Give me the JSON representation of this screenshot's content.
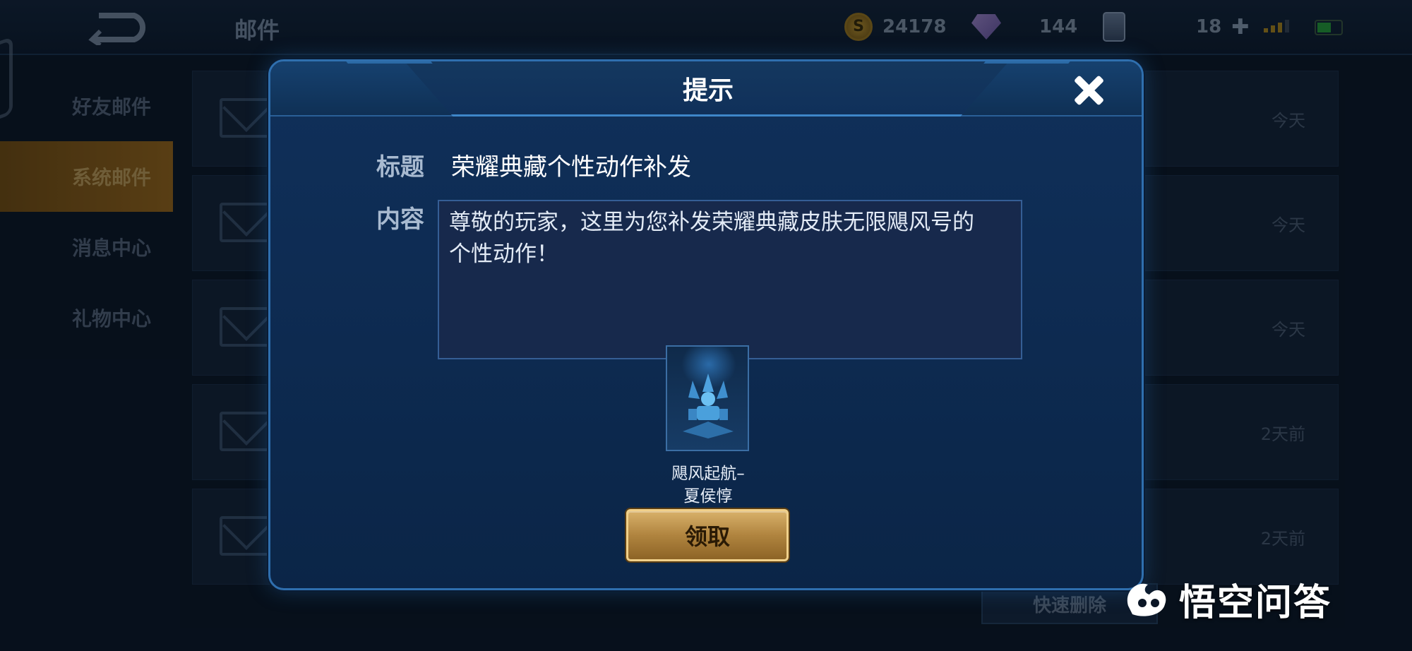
{
  "header": {
    "title": "邮件"
  },
  "resources": [
    {
      "icon": "gold-coin-icon",
      "value": "24178"
    },
    {
      "icon": "gem-icon",
      "value": "144"
    },
    {
      "icon": "card-icon",
      "value": "18"
    }
  ],
  "sidebar": {
    "items": [
      {
        "label": "好友邮件",
        "active": false
      },
      {
        "label": "系统邮件",
        "active": true
      },
      {
        "label": "消息中心",
        "active": false
      },
      {
        "label": "礼物中心",
        "active": false
      }
    ]
  },
  "mail_list": {
    "rows": [
      {
        "date": "今天"
      },
      {
        "date": "今天"
      },
      {
        "date": "今天"
      },
      {
        "date": "2天前"
      },
      {
        "date": "2天前"
      }
    ],
    "delete_label": "快速删除"
  },
  "dialog": {
    "title": "提示",
    "title_label": "标题",
    "title_value": "荣耀典藏个性动作补发",
    "content_label": "内容",
    "content_lines": [
      "尊敬的玩家，这里为您补发荣耀典藏皮肤无限飓风号的",
      "个性动作！"
    ],
    "reward": {
      "name_line1": "飓风起航–",
      "name_line2": "夏侯惇"
    },
    "claim_label": "领取"
  },
  "watermark": {
    "text": "悟空问答"
  },
  "colors": {
    "accent_gold": "#b0843f",
    "dialog_bg": "#0d2a50",
    "border_blue": "#2f6fae"
  }
}
